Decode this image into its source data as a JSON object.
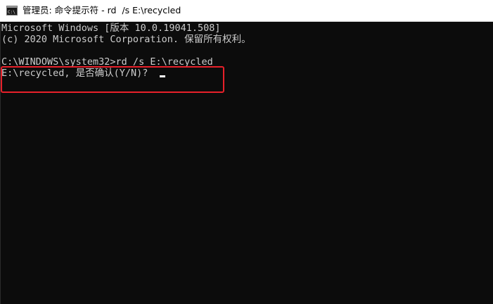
{
  "window": {
    "title": "管理员: 命令提示符 - rd  /s E:\\recycled",
    "icon": "cmd-console-icon"
  },
  "console": {
    "lines": [
      "Microsoft Windows [版本 10.0.19041.508]",
      "(c) 2020 Microsoft Corporation. 保留所有权利。",
      "",
      "C:\\WINDOWS\\system32>rd /s E:\\recycled",
      "E:\\recycled, 是否确认(Y/N)? "
    ]
  },
  "colors": {
    "background": "#0c0c0c",
    "text": "#cccccc",
    "highlight": "#e8202a",
    "titlebar": "#ffffff"
  }
}
